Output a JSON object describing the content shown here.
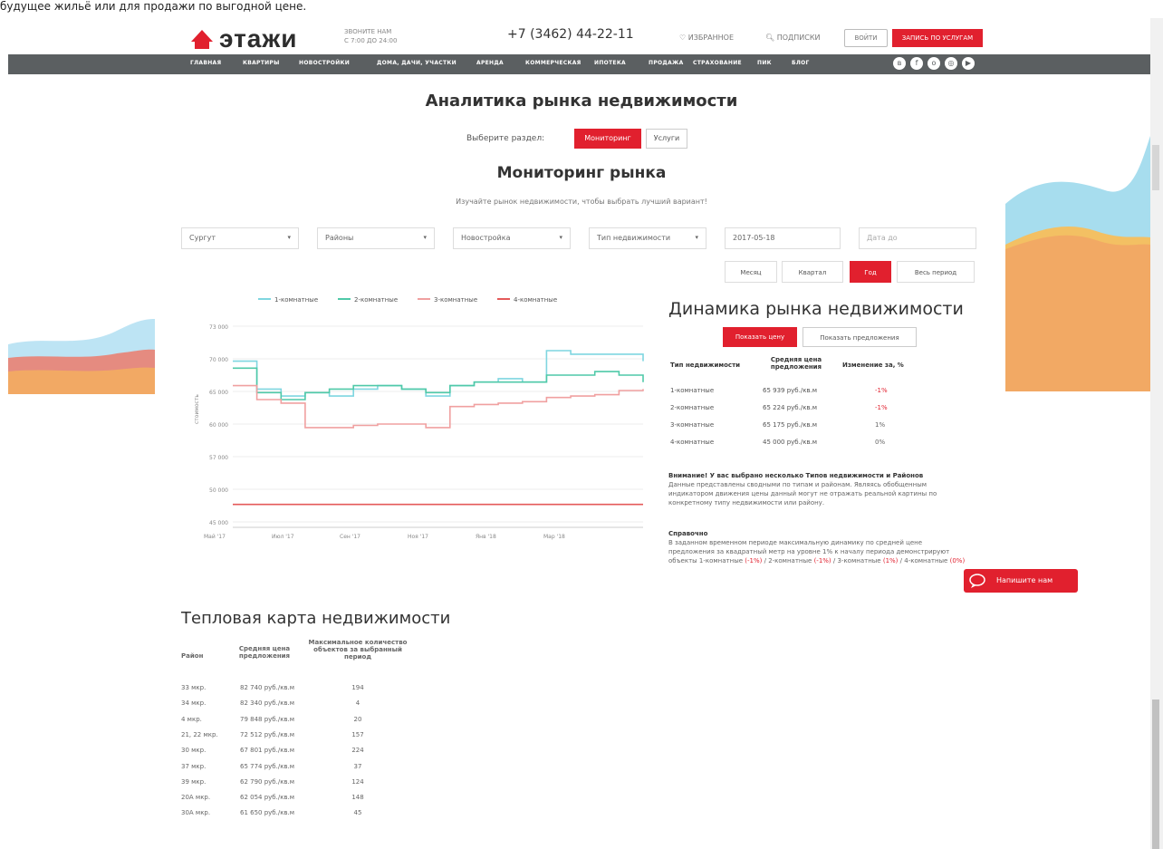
{
  "caption": "будущее жильё или для продажи по выгодной цене.",
  "header": {
    "logo": "этажи",
    "callus_line1": "ЗВОНИТЕ НАМ",
    "callus_line2": "С 7:00 ДО 24:00",
    "phone": "+7 (3462) 44-22-11",
    "favorites": "ИЗБРАННОЕ",
    "subscriptions": "ПОДПИСКИ",
    "login": "ВОЙТИ",
    "cta": "ЗАПИСЬ ПО УСЛУГАМ"
  },
  "nav": {
    "items": [
      "ГЛАВНАЯ",
      "КВАРТИРЫ",
      "НОВОСТРОЙКИ",
      "ДОМА, ДАЧИ, УЧАСТКИ",
      "АРЕНДА",
      "КОММЕРЧЕСКАЯ",
      "ИПОТЕКА",
      "ПРОДАЖА",
      "СТРАХОВАНИЕ",
      "ПИК",
      "БЛОГ"
    ],
    "social": [
      "vk",
      "f",
      "ok",
      "inst",
      "yt"
    ]
  },
  "page": {
    "title": "Аналитика рынка недвижимости",
    "choose_label": "Выберите раздел:",
    "section_active": "Мониторинг",
    "section_other": "Услуги",
    "subtitle": "Мониторинг рынка",
    "description": "Изучайте рынок недвижимости, чтобы выбрать лучший вариант!"
  },
  "filters": {
    "city": "Сургут",
    "district": "Районы",
    "building": "Новостройка",
    "type": "Тип недвижимости",
    "date_from": "2017-05-18",
    "date_to": "Дата до",
    "periods": [
      "Месяц",
      "Квартал",
      "Год",
      "Весь период"
    ],
    "active_period": "Год"
  },
  "chart_data": {
    "type": "line",
    "ylabel": "стоимость",
    "yticks": [
      "73 000",
      "70 000",
      "65 000",
      "60 000",
      "57 000",
      "50 000",
      "45 000"
    ],
    "xticks": [
      "Май '17",
      "Июл '17",
      "Сен '17",
      "Ноя '17",
      "Янв '18",
      "Мар '18"
    ],
    "legend": [
      "1-комнатные",
      "2-комнатные",
      "3-комнатные",
      "4-комнатные"
    ],
    "colors": [
      "#7fd6e0",
      "#4fc9a8",
      "#f0a0a0",
      "#e45a5a"
    ],
    "ylim": [
      45000,
      73000
    ],
    "series": [
      {
        "name": "1-комнатные",
        "values": [
          68000,
          64000,
          63000,
          63500,
          63000,
          64000,
          64500,
          64000,
          63000,
          64500,
          65000,
          65500,
          65000,
          69500,
          69000,
          69000,
          69000,
          68000
        ]
      },
      {
        "name": "2-комнатные",
        "values": [
          67000,
          63500,
          62500,
          63500,
          64000,
          64500,
          64500,
          64000,
          63500,
          64500,
          65000,
          65000,
          65000,
          66000,
          66000,
          66500,
          66000,
          65000
        ]
      },
      {
        "name": "3-комнатные",
        "values": [
          64500,
          62500,
          62000,
          58500,
          58500,
          58800,
          59000,
          59000,
          58500,
          61500,
          61800,
          62000,
          62200,
          62800,
          63000,
          63200,
          63800,
          64000
        ]
      },
      {
        "name": "4-комнатные",
        "values": [
          47500,
          47500,
          47500,
          47500,
          47500,
          47500,
          47500,
          47500,
          47500,
          47500,
          47500,
          47500,
          47500,
          47500,
          47500,
          47500,
          47500,
          47500
        ]
      }
    ]
  },
  "dynamics": {
    "title": "Динамика рынка недвижимости",
    "btn_price": "Показать цену",
    "btn_offers": "Показать предложения",
    "headers": [
      "Тип недвижимости",
      "Средняя цена предложения",
      "Изменение за, %"
    ],
    "rows": [
      {
        "type": "1-комнатные",
        "price": "65 939 руб./кв.м",
        "change": "-1%"
      },
      {
        "type": "2-комнатные",
        "price": "65 224 руб./кв.м",
        "change": "-1%"
      },
      {
        "type": "3-комнатные",
        "price": "65 175 руб./кв.м",
        "change": "1%"
      },
      {
        "type": "4-комнатные",
        "price": "45 000 руб./кв.м",
        "change": "0%"
      }
    ],
    "warning_title": "Внимание! У вас выбрано несколько Типов недвижимости и Районов",
    "warning_text": "Данные представлены сводными по типам и районам. Являясь обобщенным индикатором движения цены данный могут не отражать реальной картины по конкретному типу недвижимости или району.",
    "ref_title": "Справочно",
    "ref_text": "В заданном временном периоде максимальную динамику по средней цене предложения за квадратный метр на уровне 1% к началу периода демонстрируют объекты 1-комнатные",
    "ref_links": [
      "(-1%)",
      "/ 2-комнатные",
      "(-1%)",
      "/ 3-комнатные",
      "(1%)",
      "/ 4-комнатные",
      "(0%)"
    ]
  },
  "chat": {
    "label": "Напишите нам"
  },
  "heatmap": {
    "title": "Тепловая карта недвижимости",
    "headers": [
      "Район",
      "Средняя цена предложения",
      "Максимальное количество объектов за выбранный период"
    ],
    "rows": [
      {
        "district": "33 мкр.",
        "price": "82 740 руб./кв.м",
        "count": "194"
      },
      {
        "district": "34 мкр.",
        "price": "82 340 руб./кв.м",
        "count": "4"
      },
      {
        "district": "4 мкр.",
        "price": "79 848 руб./кв.м",
        "count": "20"
      },
      {
        "district": "21, 22 мкр.",
        "price": "72 512 руб./кв.м",
        "count": "157"
      },
      {
        "district": "30 мкр.",
        "price": "67 801 руб./кв.м",
        "count": "224"
      },
      {
        "district": "37 мкр.",
        "price": "65 774 руб./кв.м",
        "count": "37"
      },
      {
        "district": "39 мкр.",
        "price": "62 790 руб./кв.м",
        "count": "124"
      },
      {
        "district": "20А мкр.",
        "price": "62 054 руб./кв.м",
        "count": "148"
      },
      {
        "district": "30А мкр.",
        "price": "61 650 руб./кв.м",
        "count": "45"
      }
    ]
  }
}
